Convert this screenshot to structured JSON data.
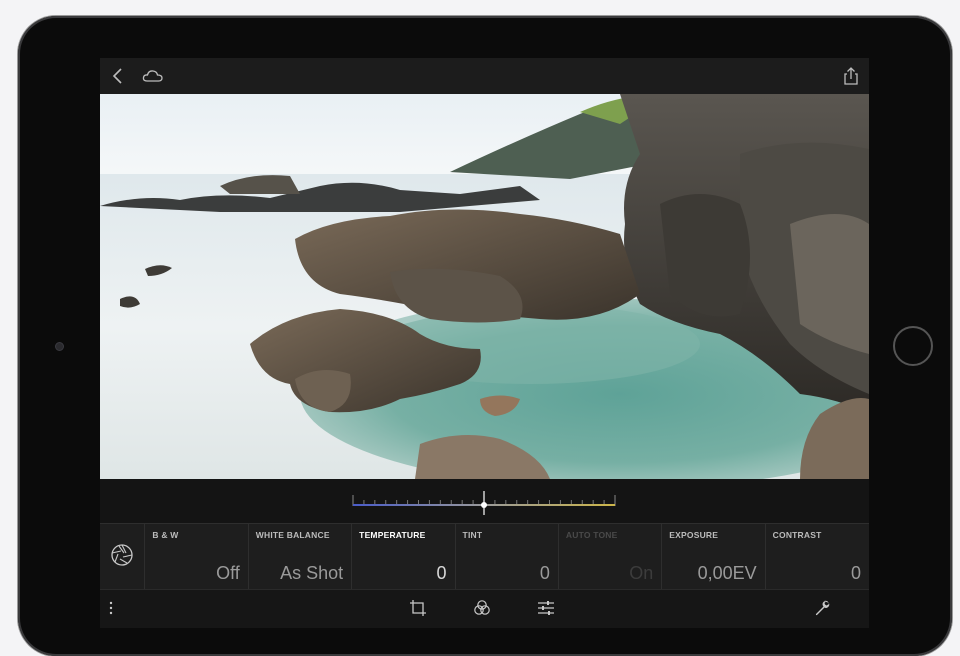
{
  "photo": {
    "subject": "long-exposure seascape with rocky coastline"
  },
  "slider": {
    "position_fraction": 0.5
  },
  "tools": [
    {
      "label": "B & W",
      "value": "Off",
      "state": "normal"
    },
    {
      "label": "WHITE BALANCE",
      "value": "As Shot",
      "state": "normal"
    },
    {
      "label": "TEMPERATURE",
      "value": "0",
      "state": "active"
    },
    {
      "label": "TINT",
      "value": "0",
      "state": "normal"
    },
    {
      "label": "AUTO TONE",
      "value": "On",
      "state": "disabled"
    },
    {
      "label": "EXPOSURE",
      "value": "0,00EV",
      "state": "normal"
    },
    {
      "label": "CONTRAST",
      "value": "0",
      "state": "normal"
    }
  ],
  "icons": {
    "top_left": [
      "back-icon",
      "cloud-icon"
    ],
    "top_right": [
      "share-icon"
    ],
    "panel_left": "aperture-icon",
    "bottom": [
      "more-icon",
      "crop-icon",
      "profile-icon",
      "adjust-icon",
      "wrench-icon"
    ]
  },
  "colors": {
    "device_frame": "#0b0b0b",
    "screen_bg": "#1a1a1a",
    "active_label": "#ffffff",
    "slider_thumb": "#ffffff"
  }
}
